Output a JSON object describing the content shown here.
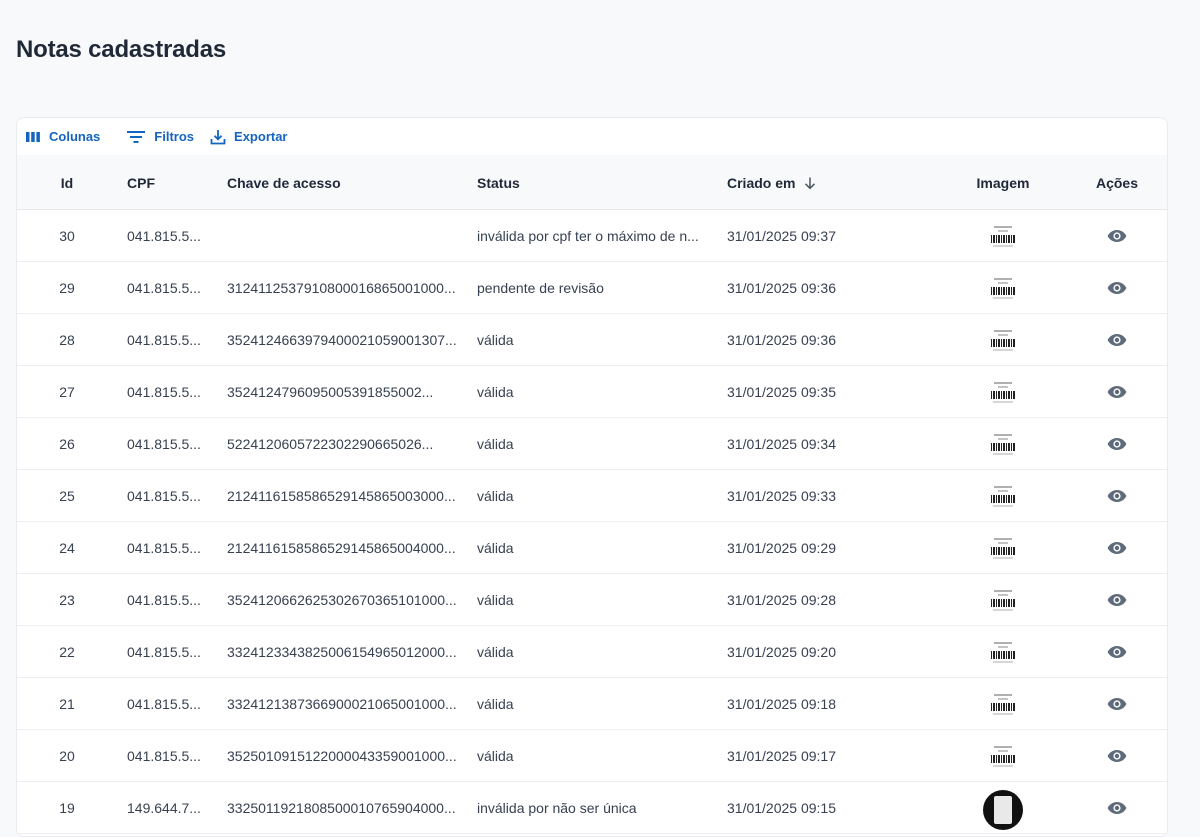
{
  "page": {
    "title": "Notas cadastradas"
  },
  "toolbar": {
    "columns_label": "Colunas",
    "filters_label": "Filtros",
    "export_label": "Exportar"
  },
  "table": {
    "headers": {
      "id": "Id",
      "cpf": "CPF",
      "key": "Chave de acesso",
      "status": "Status",
      "created": "Criado em",
      "image": "Imagem",
      "actions": "Ações"
    },
    "sort": {
      "column": "created",
      "direction": "desc"
    },
    "rows": [
      {
        "id": "30",
        "cpf": "041.815.5...",
        "key": "",
        "status": "inválida por cpf ter o máximo de n...",
        "created": "31/01/2025 09:37",
        "image": "receipt-thumbnail"
      },
      {
        "id": "29",
        "cpf": "041.815.5...",
        "key": "3124112537910800016865001000...",
        "status": "pendente de revisão",
        "created": "31/01/2025 09:36",
        "image": "receipt-thumbnail"
      },
      {
        "id": "28",
        "cpf": "041.815.5...",
        "key": "3524124663979400021059001307...",
        "status": "válida",
        "created": "31/01/2025 09:36",
        "image": "receipt-thumbnail"
      },
      {
        "id": "27",
        "cpf": "041.815.5...",
        "key": "3524124796095005391855002...",
        "status": "válida",
        "created": "31/01/2025 09:35",
        "image": "receipt-thumbnail"
      },
      {
        "id": "26",
        "cpf": "041.815.5...",
        "key": "5224120605722302290665026...",
        "status": "válida",
        "created": "31/01/2025 09:34",
        "image": "receipt-thumbnail"
      },
      {
        "id": "25",
        "cpf": "041.815.5...",
        "key": "2124116158586529145865003000...",
        "status": "válida",
        "created": "31/01/2025 09:33",
        "image": "receipt-thumbnail"
      },
      {
        "id": "24",
        "cpf": "041.815.5...",
        "key": "2124116158586529145865004000...",
        "status": "válida",
        "created": "31/01/2025 09:29",
        "image": "receipt-thumbnail"
      },
      {
        "id": "23",
        "cpf": "041.815.5...",
        "key": "3524120662625302670365101000...",
        "status": "válida",
        "created": "31/01/2025 09:28",
        "image": "receipt-thumbnail"
      },
      {
        "id": "22",
        "cpf": "041.815.5...",
        "key": "3324123343825006154965012000...",
        "status": "válida",
        "created": "31/01/2025 09:20",
        "image": "receipt-thumbnail"
      },
      {
        "id": "21",
        "cpf": "041.815.5...",
        "key": "3324121387366900021065001000...",
        "status": "válida",
        "created": "31/01/2025 09:18",
        "image": "receipt-thumbnail"
      },
      {
        "id": "20",
        "cpf": "041.815.5...",
        "key": "3525010915122000043359001000...",
        "status": "válida",
        "created": "31/01/2025 09:17",
        "image": "receipt-thumbnail"
      },
      {
        "id": "19",
        "cpf": "149.644.7...",
        "key": "3325011921808500010765904000...",
        "status": "inválida por não ser única",
        "created": "31/01/2025 09:15",
        "image": "receipt-photo-round"
      }
    ]
  },
  "icons": {
    "columns": "columns-icon",
    "filters": "filter-icon",
    "export": "download-icon",
    "sort": "arrow-down-icon",
    "view": "eye-icon"
  },
  "colors": {
    "accent": "#1565c0",
    "icon_gray": "#5f6b7a"
  }
}
